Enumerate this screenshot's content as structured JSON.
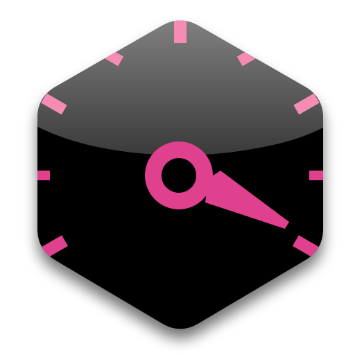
{
  "app_icon": {
    "name": "clock-icon",
    "shape": "hexagon",
    "colors": {
      "face": "#000000",
      "gloss_top": "#8a8a8a",
      "gloss_bottom": "#3a3a3a",
      "accent": "#e0418f",
      "accent_light": "#f48cb4",
      "shadow": "#000000",
      "background": "#ffffff"
    },
    "hour_markers": 12,
    "hand": {
      "shape": "tapered-hand-with-ring-hub",
      "direction": "lower-right"
    }
  }
}
